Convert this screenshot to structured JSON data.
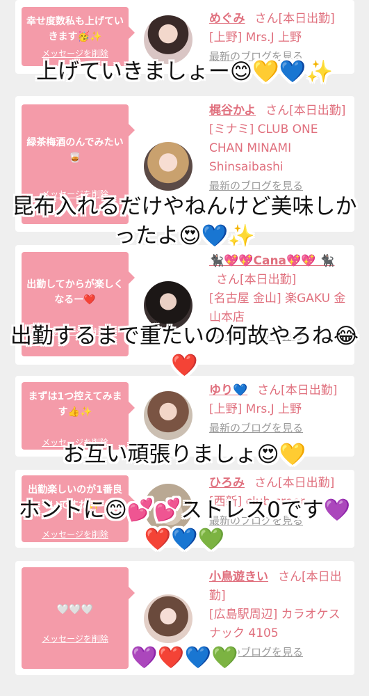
{
  "delete_label": "メッセージを削除",
  "blog_label": "最新のブログを見る",
  "san_label": "さん",
  "cards": [
    {
      "msg": "幸せ度数私も上げていきます🥳✨",
      "name": "めぐみ",
      "status": "[本日出勤]",
      "location": "[上野] Mrs.J 上野"
    },
    {
      "msg": "緑茶梅酒のんでみたい🥃",
      "name": "梶谷かよ",
      "status": "[本日出勤]",
      "location": "[ミナミ] CLUB ONE CHAN MINAMI Shinsaibashi"
    },
    {
      "msg": "出勤してからが楽しくなるー❤️",
      "name": "🐈‍⬛💖💖Cana💖💖 🐈‍⬛",
      "status": "[本日出勤]",
      "location": "[名古屋 金山] 楽GAKU 金山本店"
    },
    {
      "msg": "まずは1つ控えてみます👍✨",
      "name": "ゆり💙",
      "status": "[本日出勤]",
      "location": "[上野] Mrs.J 上野"
    },
    {
      "msg": "出勤楽しいのが1番良いですね✨",
      "name": "ひろみ",
      "status": "[本日出勤]",
      "location": "[西新] club creer"
    },
    {
      "msg": "🤍🤍🤍",
      "name": "小鳥遊きい",
      "status": "[本日出勤]",
      "location": "[広島駅周辺] カラオケスナック 4105"
    }
  ],
  "captions": [
    "上げていきましょー😊💛💙✨",
    "昆布入れるだけやねんけど美味しかったよ😍💙✨",
    "出勤するまで重たいの何故やろね😂❤️",
    "お互い頑張りましょ😍💛",
    "ホントに😊💕💕ストレス0です💜❤️💙💚",
    "💜❤️💙💚"
  ],
  "colors": {
    "bubble": "#f49ba9",
    "accent": "#e0707e",
    "background": "#efefef",
    "muted": "#9a9a9a"
  }
}
